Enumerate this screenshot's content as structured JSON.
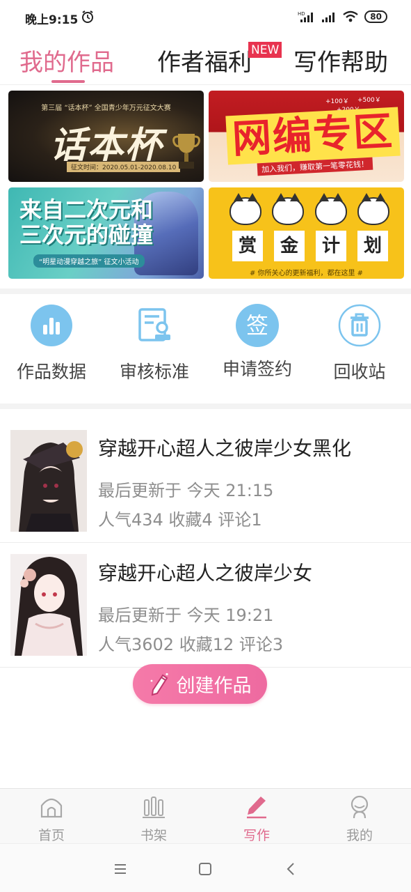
{
  "status_bar": {
    "time": "晚上9:15",
    "battery": "80",
    "icons": [
      "alarm-icon",
      "hd-signal-icon",
      "signal-icon",
      "wifi-icon",
      "battery-icon"
    ]
  },
  "top_tabs": [
    {
      "label": "我的作品",
      "active": true
    },
    {
      "label": "作者福利",
      "active": false,
      "badge": "NEW"
    },
    {
      "label": "写作帮助",
      "active": false
    }
  ],
  "banners": [
    {
      "id": "huaben",
      "top_text": "第三届 “话本杯” 全国青少年万元征文大赛",
      "title": "话本杯",
      "date": "征文时间：2020.05.01-2020.08.10"
    },
    {
      "id": "wangbian",
      "title": "网编专区",
      "subtitle": "加入我们，赚取第一笔零花钱！",
      "coins": [
        "+100￥",
        "+500￥",
        "+200￥"
      ]
    },
    {
      "id": "erciyuan",
      "title": "来自二次元和三次元的碰撞",
      "subtitle": "“明星动漫穿越之旅” 征文小活动"
    },
    {
      "id": "shangjin",
      "cards": [
        "赏",
        "金",
        "计",
        "划"
      ],
      "subtitle": "# 你所关心的更新福利，都在这里 #"
    }
  ],
  "actions": [
    {
      "label": "作品数据",
      "icon": "bar-chart-icon"
    },
    {
      "label": "审核标准",
      "icon": "review-doc-icon"
    },
    {
      "label": "申请签约",
      "icon": "sign-icon",
      "glyph": "签"
    },
    {
      "label": "回收站",
      "icon": "trash-icon"
    }
  ],
  "works": [
    {
      "title": "穿越开心超人之彼岸少女黑化",
      "update": "最后更新于 今天 21:15",
      "stats": "人气434 收藏4 评论1"
    },
    {
      "title": "穿越开心超人之彼岸少女",
      "update": "最后更新于 今天 19:21",
      "stats": "人气3602 收藏12 评论3"
    }
  ],
  "create_button": {
    "label": "创建作品"
  },
  "bottom_nav": [
    {
      "label": "首页",
      "icon": "home-icon",
      "active": false
    },
    {
      "label": "书架",
      "icon": "bookshelf-icon",
      "active": false
    },
    {
      "label": "写作",
      "icon": "pen-icon",
      "active": true
    },
    {
      "label": "我的",
      "icon": "profile-icon",
      "active": false
    }
  ],
  "colors": {
    "accent": "#e06a8d",
    "new_badge": "#e8334f",
    "icon_blue": "#7cc4ee"
  }
}
